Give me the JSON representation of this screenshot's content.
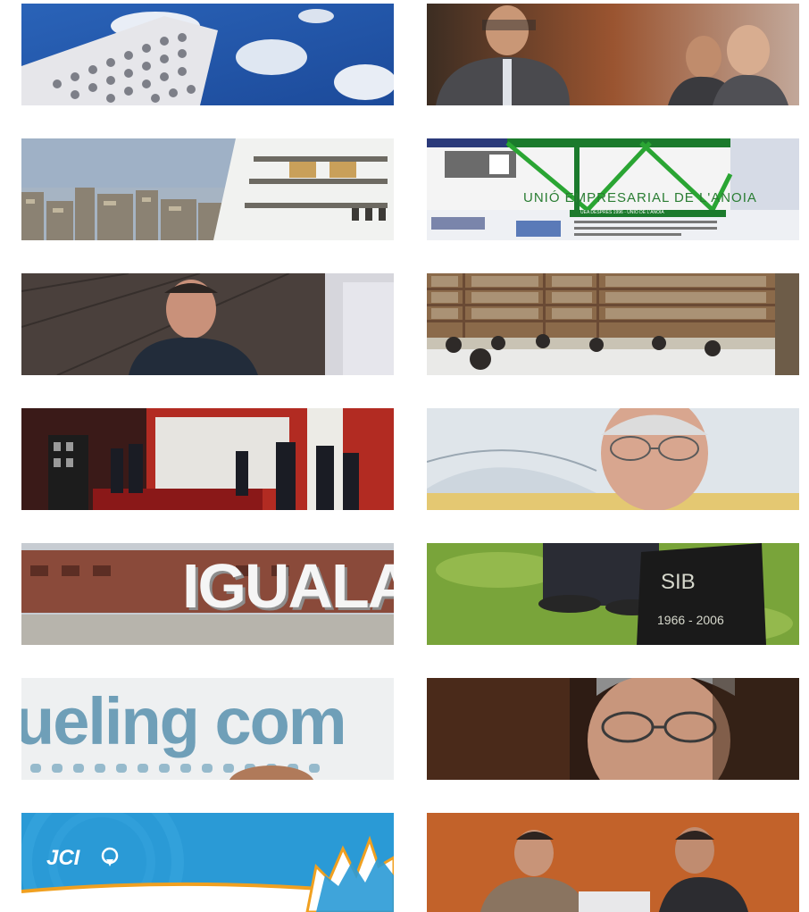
{
  "thumbnails": [
    {
      "id": "t1",
      "icon": "building-sky-photo"
    },
    {
      "id": "t2",
      "icon": "three-men-photo"
    },
    {
      "id": "t3",
      "icon": "city-ship-photo"
    },
    {
      "id": "t4",
      "icon": "website-screenshot",
      "overlay": {
        "text": "UNIÓ EMPRESARIAL DE L'ANOIA",
        "bar_text": "UEA DESPRÉS 1996 - UNIÓ DE L'ANOIA"
      }
    },
    {
      "id": "t5",
      "icon": "man-portrait-photo"
    },
    {
      "id": "t6",
      "icon": "library-photo"
    },
    {
      "id": "t7",
      "icon": "trade-fair-photo"
    },
    {
      "id": "t8",
      "icon": "man-glasses-photo"
    },
    {
      "id": "t9",
      "icon": "igualada-letters-photo",
      "overlay": {
        "text": "IGUALADA"
      }
    },
    {
      "id": "t10",
      "icon": "plaque-grass-photo",
      "overlay": {
        "line1": "SIB",
        "line2": "1966 - 2006"
      }
    },
    {
      "id": "t11",
      "icon": "sign-letters-photo",
      "overlay": {
        "text": "ueling com"
      }
    },
    {
      "id": "t12",
      "icon": "man-face-closeup-photo"
    },
    {
      "id": "t13",
      "icon": "jci-banner",
      "overlay": {
        "text": "JCI"
      }
    },
    {
      "id": "t14",
      "icon": "two-men-photo"
    }
  ]
}
